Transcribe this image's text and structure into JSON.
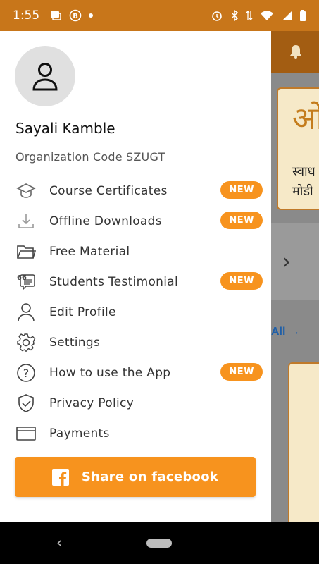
{
  "status_bar": {
    "time": "1:55"
  },
  "background_app": {
    "view_all_label": "All →",
    "deva_1": "ओ",
    "deva_2": "स्वाध",
    "deva_3": "मोडी"
  },
  "drawer": {
    "user_name": "Sayali Kamble",
    "org_code": "Organization Code SZUGT",
    "menu": [
      {
        "label": "Course Certificates",
        "icon": "graduation-cap-icon",
        "badge": "NEW"
      },
      {
        "label": "Offline Downloads",
        "icon": "download-icon",
        "badge": "NEW"
      },
      {
        "label": "Free Material",
        "icon": "folder-icon",
        "badge": ""
      },
      {
        "label": "Students Testimonial",
        "icon": "testimonial-quote-icon",
        "badge": "NEW"
      },
      {
        "label": "Edit Profile",
        "icon": "user-icon",
        "badge": ""
      },
      {
        "label": "Settings",
        "icon": "gear-icon",
        "badge": ""
      },
      {
        "label": "How to use the App",
        "icon": "help-icon",
        "badge": "NEW"
      },
      {
        "label": "Privacy Policy",
        "icon": "shield-check-icon",
        "badge": ""
      },
      {
        "label": "Payments",
        "icon": "card-icon",
        "badge": ""
      }
    ],
    "share_button": {
      "label": "Share on facebook",
      "icon": "facebook-icon"
    }
  },
  "colors": {
    "accent": "#f7931e",
    "status_bar": "#c8761a"
  }
}
